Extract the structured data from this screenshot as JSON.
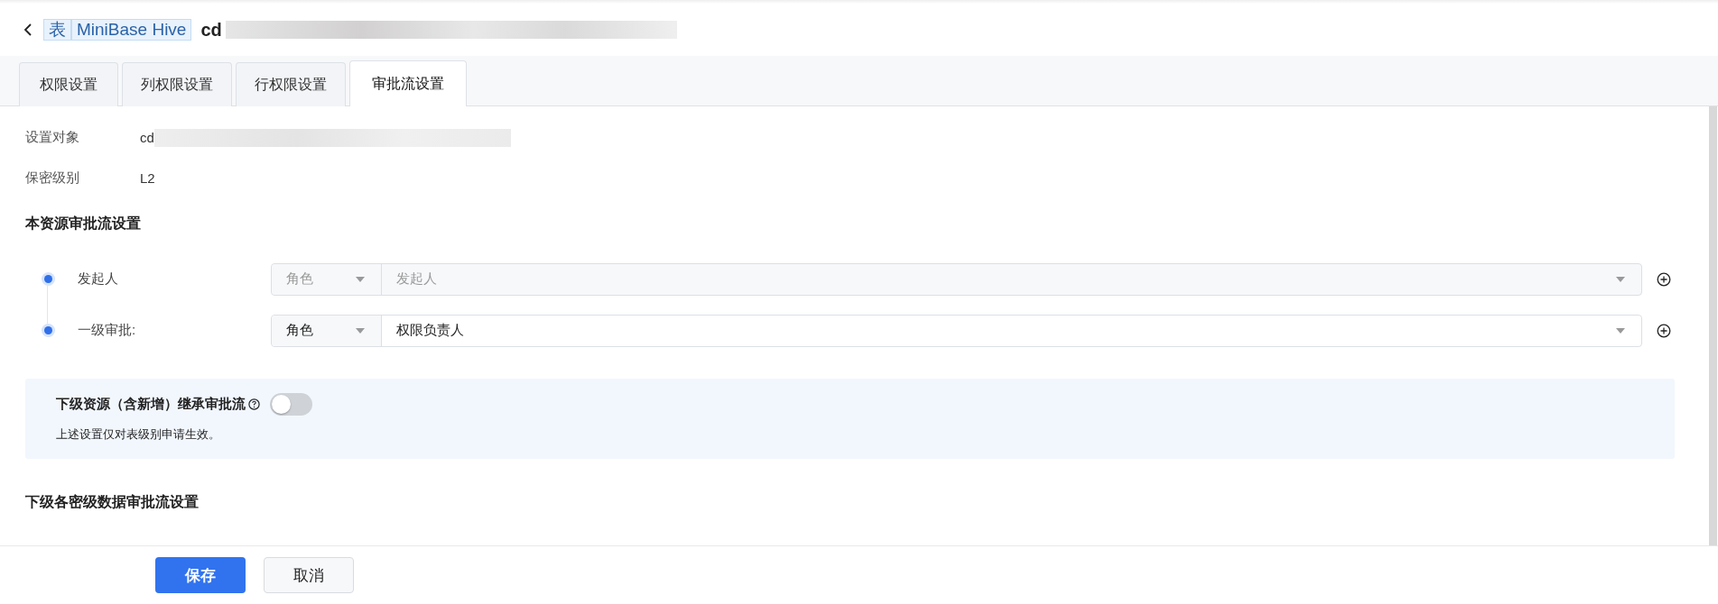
{
  "header": {
    "type_tag": "表",
    "source_tag": "MiniBase Hive",
    "name": "cd"
  },
  "tabs": [
    {
      "label": "权限设置",
      "selected": false
    },
    {
      "label": "列权限设置",
      "selected": false
    },
    {
      "label": "行权限设置",
      "selected": false
    },
    {
      "label": "审批流设置",
      "selected": true
    }
  ],
  "info": [
    {
      "label": "设置对象",
      "value": "cd"
    },
    {
      "label": "保密级别",
      "value": "L2"
    }
  ],
  "section_title": "本资源审批流设置",
  "flow": [
    {
      "label": "发起人",
      "role": "角色",
      "value": "发起人",
      "disabled": true
    },
    {
      "label": "一级审批:",
      "role": "角色",
      "value": "权限负责人",
      "disabled": false
    }
  ],
  "inherit": {
    "label": "下级资源（含新增）继承审批流",
    "on": false,
    "note": "上述设置仅对表级别申请生效。"
  },
  "section2_title": "下级各密级数据审批流设置",
  "buttons": [
    {
      "label": "保存",
      "kind": "primary"
    },
    {
      "label": "取消",
      "kind": "default"
    }
  ]
}
